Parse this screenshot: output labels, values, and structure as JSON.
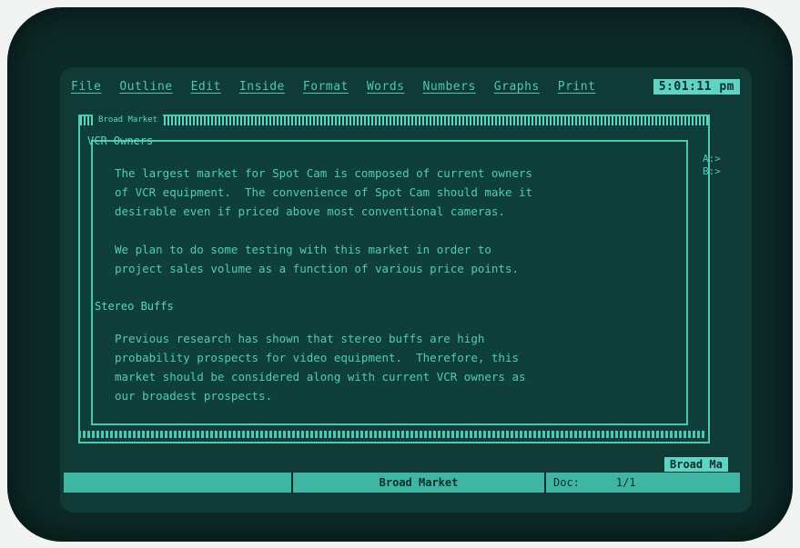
{
  "menu": {
    "items": [
      "File",
      "Outline",
      "Edit",
      "Inside",
      "Format",
      "Words",
      "Numbers",
      "Graphs",
      "Print"
    ],
    "clock": "5:01:11 pm"
  },
  "window": {
    "title": "Broad Market"
  },
  "sections": [
    {
      "heading": "VCR Owners",
      "paragraphs": [
        "The largest market for Spot Cam is composed of current owners\nof VCR equipment.  The convenience of Spot Cam should make it\ndesirable even if priced above most conventional cameras.",
        "We plan to do some testing with this market in order to\nproject sales volume as a function of various price points."
      ]
    },
    {
      "heading": "Stereo Buffs",
      "paragraphs": [
        "Previous research has shown that stereo buffs are high\nprobability prospects for video equipment.  Therefore, this\nmarket should be considered along with current VCR owners as\nour broadest prospects."
      ]
    }
  ],
  "side_marks": "A:>\nB:>",
  "status": {
    "doc_label": "Broad Ma",
    "center": "Broad Market",
    "doc": "Doc:",
    "page": "1/1"
  }
}
